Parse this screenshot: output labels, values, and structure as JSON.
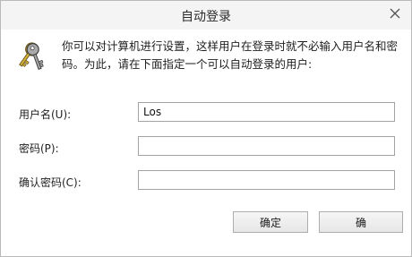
{
  "window": {
    "title": "自动登录"
  },
  "header": {
    "description": "你可以对计算机进行设置，这样用户在登录时就不必输入用户名和密码。为此，请在下面指定一个可以自动登录的用户:"
  },
  "form": {
    "username_label": "用户名(U):",
    "username_value": "Los",
    "password_label": "密码(P):",
    "password_value": "",
    "confirm_label": "确认密码(C):",
    "confirm_value": ""
  },
  "buttons": {
    "ok_label": "确定",
    "cancel_label": "确"
  },
  "icons": {
    "header_icon": "keys-icon",
    "close_icon": "close-icon"
  }
}
